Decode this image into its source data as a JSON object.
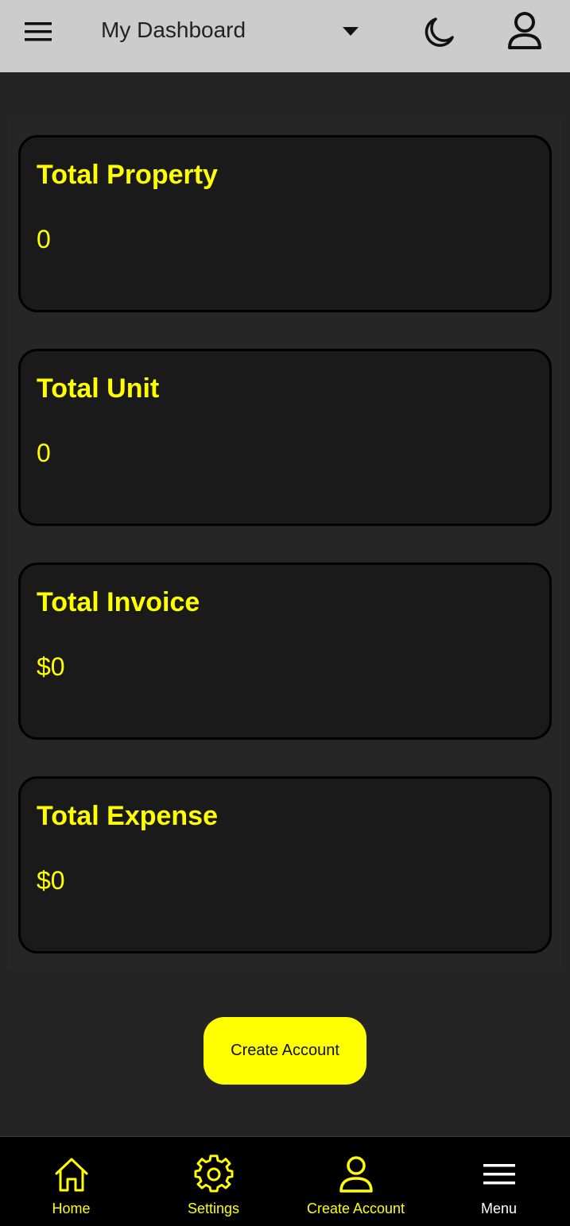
{
  "header": {
    "title": "My Dashboard",
    "menu_icon": "hamburger-icon",
    "dropdown_icon": "caret-down-icon",
    "theme_icon": "moon-icon",
    "profile_icon": "user-icon"
  },
  "cards": [
    {
      "title": "Total Property",
      "value": "0"
    },
    {
      "title": "Total Unit",
      "value": "0"
    },
    {
      "title": "Total Invoice",
      "value": "$0"
    },
    {
      "title": "Total Expense",
      "value": "$0"
    }
  ],
  "create_account_button": "Create Account",
  "bottom_nav": [
    {
      "label": "Home",
      "icon": "home-icon"
    },
    {
      "label": "Settings",
      "icon": "gear-icon"
    },
    {
      "label": "Create Account",
      "icon": "user-icon"
    },
    {
      "label": "Menu",
      "icon": "hamburger-icon"
    }
  ],
  "colors": {
    "accent": "#ffff00",
    "header_bg": "#cccccc",
    "background": "#242424",
    "card_bg": "#1a1a1a",
    "nav_bg": "#000000"
  }
}
